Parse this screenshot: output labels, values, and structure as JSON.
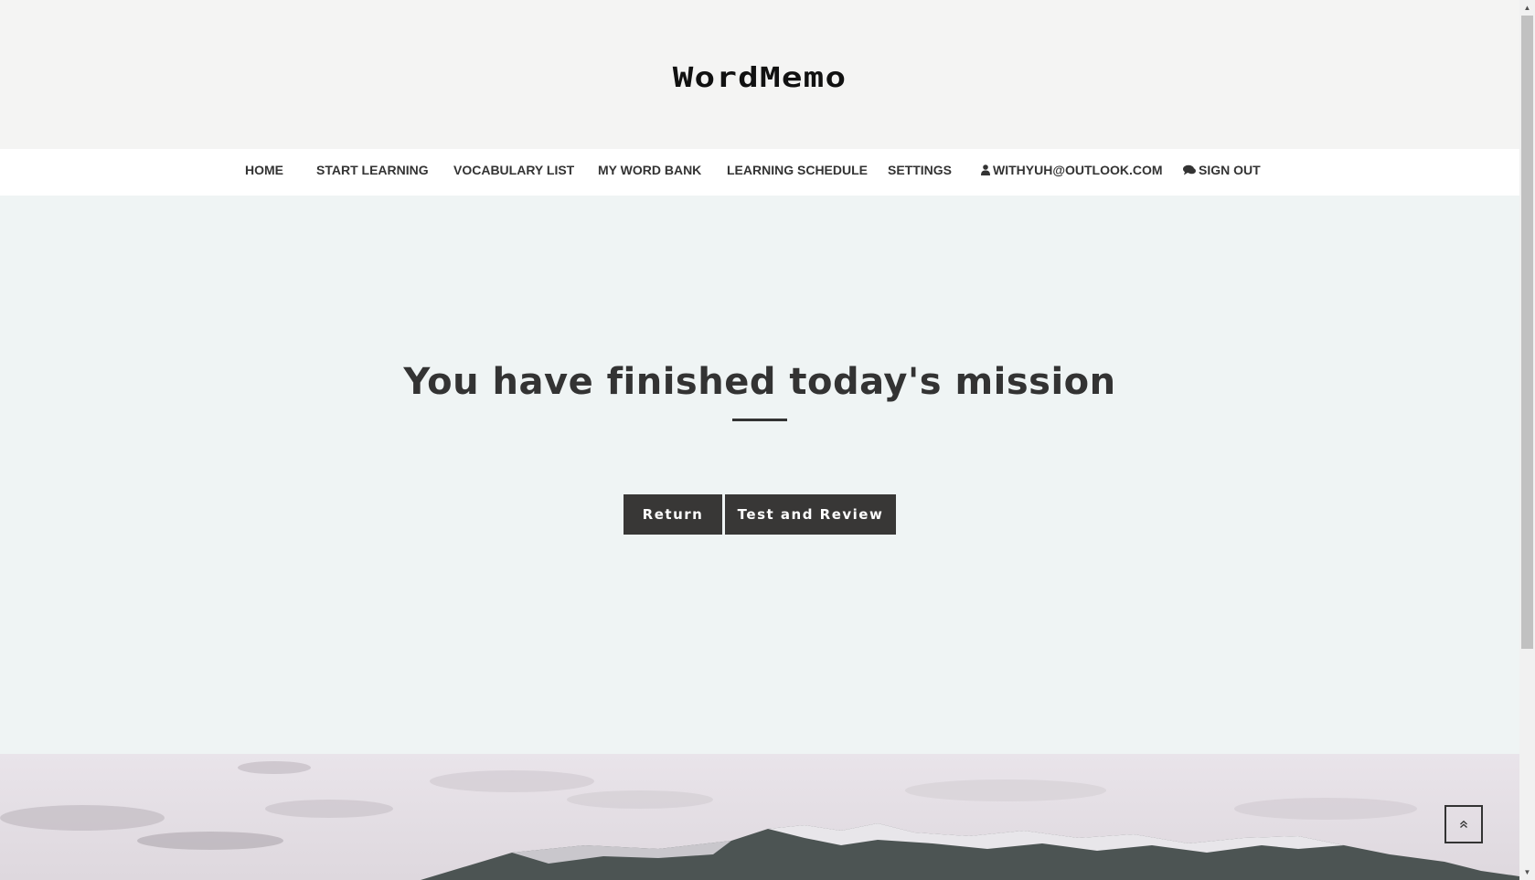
{
  "brand": {
    "logo": "WordMemo"
  },
  "nav": {
    "items": [
      {
        "label": "HOME"
      },
      {
        "label": "START LEARNING"
      },
      {
        "label": "VOCABULARY LIST"
      },
      {
        "label": "MY WORD BANK"
      },
      {
        "label": "LEARNING SCHEDULE"
      },
      {
        "label": "SETTINGS"
      },
      {
        "label": "WITHYUH@OUTLOOK.COM",
        "icon": "user-icon"
      },
      {
        "label": "SIGN OUT",
        "icon": "comments-icon"
      }
    ]
  },
  "main": {
    "headline": "You have finished today's mission",
    "buttons": {
      "return_label": "Return",
      "test_label": "Test and Review"
    }
  },
  "back_to_top": {
    "icon": "double-chevron-up-icon",
    "glyph": "«"
  },
  "colors": {
    "header_bg": "#f4f4f3",
    "nav_bg": "#ffffff",
    "main_bg": "#eff4f4",
    "button_bg": "#383736",
    "text": "#333333"
  }
}
